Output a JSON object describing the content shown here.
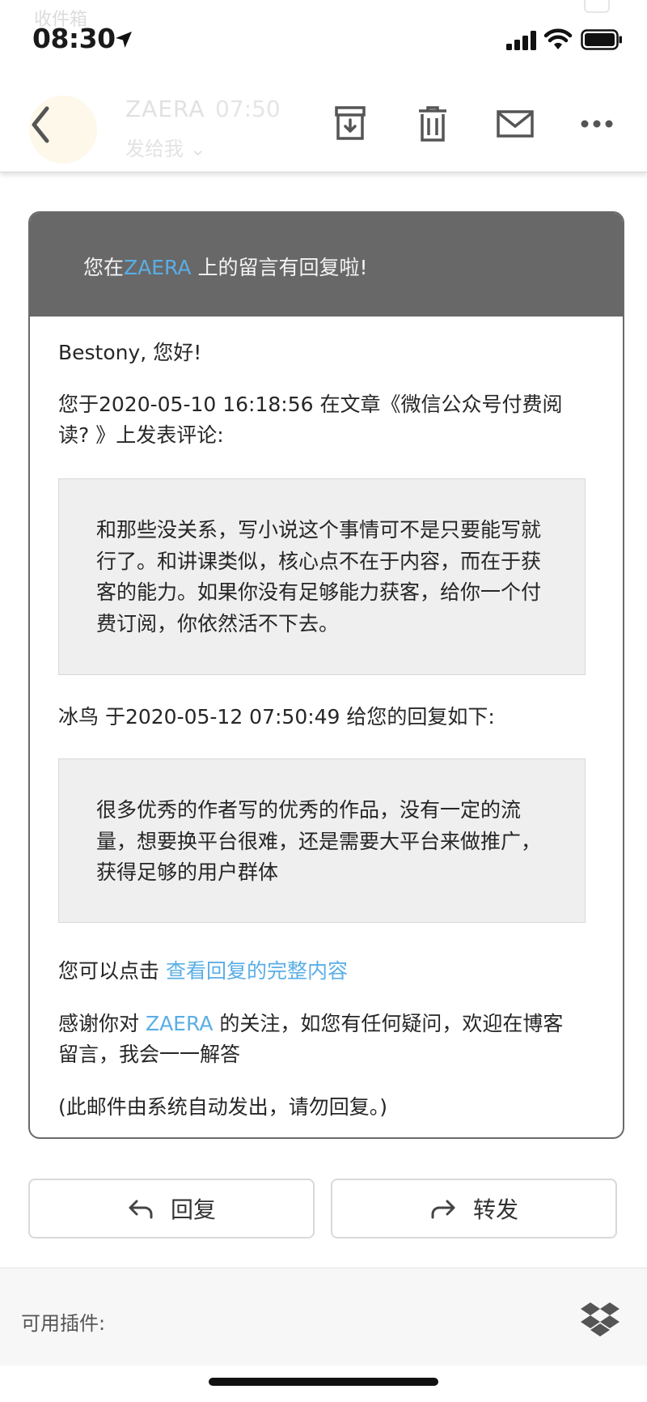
{
  "status_bar": {
    "ghost_folder_title": "收件箱",
    "time": "08:30"
  },
  "toolbar": {
    "sender_name": "ZAERA",
    "sender_time": "07:50",
    "recipient": "发给我 ⌄",
    "icons": [
      "back-icon",
      "archive-icon",
      "trash-icon",
      "mail-icon",
      "more-icon"
    ]
  },
  "card": {
    "header_pre": "您在",
    "header_brand": "ZAERA",
    "header_post": " 上的留言有回复啦!",
    "greeting": "Bestony, 您好!",
    "comment_intro_line1": "您于2020-05-10 16:18:56 在文章《微信公众号付费阅",
    "comment_intro_line2": "读? 》上发表评论:",
    "comment_lines": [
      "和那些没关系，写小说这个事情可不是只要能写就",
      "行了。和讲课类似，核心点不在于内容，而在于获",
      "客的能力。如果你没有足够能力获客，给你一个付",
      "费订阅，你依然活不下去。"
    ],
    "reply_intro": "冰鸟 于2020-05-12 07:50:49 给您的回复如下:",
    "reply_lines": [
      "很多优秀的作者写的优秀的作品，没有一定的流",
      "量，想要换平台很难，还是需要大平台来做推广，",
      "获得足够的用户群体"
    ],
    "click_prefix": "您可以点击 ",
    "click_link": "查看回复的完整内容",
    "thanks_pre": "感谢你对 ",
    "thanks_brand": "ZAERA",
    "thanks_post_line1": " 的关注，如您有任何疑问，欢迎在博客",
    "thanks_line2": "留言，我会一一解答",
    "auto_note": "(此邮件由系统自动发出，请勿回复。)"
  },
  "actions": {
    "reply_label": "回复",
    "forward_label": "转发"
  },
  "plugins": {
    "label": "可用插件:",
    "icon": "dropbox-icon"
  },
  "colors": {
    "accent": "#5aaee6",
    "header_bg": "#686868",
    "quote_bg": "#efefef"
  }
}
